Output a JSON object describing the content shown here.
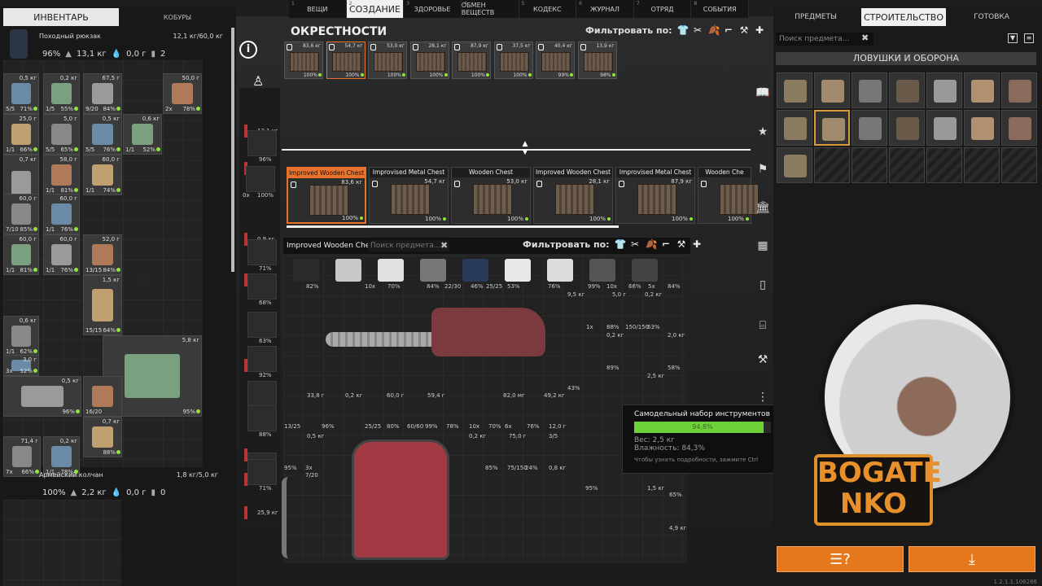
{
  "top_tabs": [
    {
      "n": "1",
      "label": "ВЕЩИ"
    },
    {
      "n": "2",
      "label": "СОЗДАНИЕ",
      "active": true
    },
    {
      "n": "3",
      "label": "ЗДОРОВЬЕ"
    },
    {
      "n": "4",
      "label": "ОБМЕН ВЕЩЕСТВ"
    },
    {
      "n": "5",
      "label": "КОДЕКС"
    },
    {
      "n": "6",
      "label": "ЖУРНАЛ"
    },
    {
      "n": "7",
      "label": "ОТРЯД"
    },
    {
      "n": "8",
      "label": "СОБЫТИЯ"
    }
  ],
  "inventory": {
    "tab_label": "ИНВЕНТАРЬ",
    "holsters_label": "КОБУРЫ",
    "backpack": {
      "name": "Походный рюкзак",
      "weight": "12,1 кг/60,0 кг",
      "condition": "96%",
      "weight2": "13,1 кг",
      "zero": "0,0 г",
      "count": "2"
    },
    "quiver": {
      "name": "Армейский колчан",
      "weight": "1,8 кг/5,0 кг",
      "condition": "100%",
      "weight2": "2,2 кг",
      "zero": "0,0 г",
      "count": "0"
    },
    "cells": [
      {
        "tr": "0,5 кг",
        "bl": "5/5",
        "br": "71%"
      },
      {
        "tr": "0,2 кг",
        "bl": "1/5",
        "br": "55%"
      },
      {
        "tr": "67,5 г",
        "bl": "9/20",
        "br": "84%"
      },
      {
        "tr": "50,0 г",
        "bl": "2x",
        "br": "78%"
      },
      {
        "tr": "25,0 г",
        "bl": "1/1",
        "br": "66%"
      },
      {
        "tr": "5,0 г",
        "bl": "5/5",
        "br": "65%"
      },
      {
        "tr": "0,5 кг",
        "bl": "5/5",
        "br": "76%"
      },
      {
        "tr": "0,6 кг",
        "bl": "1/1",
        "br": "52%"
      },
      {
        "tr": "0,7 кг",
        "bl": "1/1",
        "br": "81%"
      },
      {
        "tr": "58,0 г",
        "bl": "1/1",
        "br": "81%"
      },
      {
        "tr": "60,0 г",
        "bl": "1/1",
        "br": "74%"
      },
      {
        "tr": "60,0 г",
        "bl": "7/10",
        "br": "85%"
      },
      {
        "tr": "60,0 г",
        "bl": "1/1",
        "br": "76%"
      },
      {
        "tr": "60,0 г",
        "bl": "1/1",
        "br": "81%"
      },
      {
        "tr": "60,0 г",
        "bl": "1/1",
        "br": "76%"
      },
      {
        "tr": "52,0 г",
        "bl": "13/15",
        "br": "84%"
      },
      {
        "tr": "1,5 кг",
        "bl": "15/15",
        "br": "64%"
      },
      {
        "tr": "0,6 кг",
        "bl": "1/1",
        "br": "62%"
      },
      {
        "tr": "3,0 г",
        "bl": "3x",
        "br": "52%"
      },
      {
        "tr": "5,8 кг",
        "bl": "",
        "br": "95%"
      },
      {
        "tr": "0,5 кг",
        "bl": "",
        "br": "96%"
      },
      {
        "tr": "",
        "bl": "16/20",
        "br": ""
      },
      {
        "tr": "0,7 кг",
        "bl": "",
        "br": "88%"
      },
      {
        "tr": "71,4 г",
        "bl": "7x",
        "br": "66%"
      },
      {
        "tr": "0,2 кг",
        "bl": "1/1",
        "br": "78%"
      },
      {
        "tr": "0,6 кг",
        "bl": "3/4",
        "br": "55%"
      },
      {
        "tr": "16,0 г",
        "bl": "8x",
        "br": "21%"
      },
      {
        "tr": "20,0 г",
        "bl": "10x",
        "br": "1,0 кг"
      }
    ],
    "extra_labels": [
      "75,0 мг",
      "0,7 кг",
      "5/5",
      "95,0 мг",
      "89%",
      "0,8 кг",
      "0x"
    ]
  },
  "body": {
    "weights": [
      "13,1 кг",
      "2,2 кг",
      "0,9 кг",
      "1,5 кг",
      "0,8 кг",
      "0,5 кг",
      "1,0 кг",
      "25,9 кг"
    ],
    "percents": [
      "96%",
      "100%",
      "71%",
      "68%",
      "63%",
      "92%",
      "93%",
      "88%",
      "63%",
      "71%"
    ],
    "ratio": "0x"
  },
  "vicinity": {
    "title": "ОКРЕСТНОСТИ",
    "filter_label": "Фильтровать по:",
    "crates": [
      {
        "w": "83,6 кг",
        "p": "100%"
      },
      {
        "w": "54,7 кг",
        "p": "100%"
      },
      {
        "w": "53,0 кг",
        "p": "100%"
      },
      {
        "w": "28,1 кг",
        "p": "100%"
      },
      {
        "w": "87,9 кг",
        "p": "100%"
      },
      {
        "w": "37,5 кг",
        "p": "100%"
      },
      {
        "w": "40,4 кг",
        "p": "99%"
      },
      {
        "w": "13,9 кг",
        "p": "98%"
      }
    ],
    "big_crates": [
      {
        "name": "Improved Wooden Chest",
        "w": "83,6 кг",
        "p": "100%",
        "sel": true
      },
      {
        "name": "Improvised Metal Chest",
        "w": "54,7 кг",
        "p": "100%"
      },
      {
        "name": "Wooden Chest",
        "w": "53,0 кг",
        "p": "100%"
      },
      {
        "name": "Improved Wooden Chest",
        "w": "28,1 кг",
        "p": "100%"
      },
      {
        "name": "Improvised Metal Chest",
        "w": "87,9 кг",
        "p": "100%"
      },
      {
        "name": "Wooden Che",
        "w": "",
        "p": "100%"
      }
    ]
  },
  "container": {
    "title": "Improved Wooden Chest",
    "search_placeholder": "Поиск предмета...",
    "filter_label": "Фильтровать по:",
    "labels_row1": [
      {
        "t": "82%"
      },
      {
        "t": "10x"
      },
      {
        "t": "70%"
      },
      {
        "t": "84%"
      },
      {
        "t": "22/30"
      },
      {
        "t": "46%"
      },
      {
        "t": "25/25"
      },
      {
        "t": "53%"
      },
      {
        "t": "76%"
      },
      {
        "t": "99%"
      },
      {
        "t": "10x"
      },
      {
        "t": "66%"
      },
      {
        "t": "5x"
      },
      {
        "t": "84%"
      }
    ],
    "misc": [
      "9,5 кг",
      "5,0 г",
      "0,2 кг",
      "1x",
      "88%",
      "150/150",
      "63%",
      "0,2 кг",
      "2,0 кг",
      "89%",
      "58%",
      "2,5 кг",
      "43%",
      "33,8 г",
      "0,2 кг",
      "60,0 г",
      "59,4 г",
      "82,0 мг",
      "49,2 кг",
      "13/25",
      "96%",
      "25/25",
      "80%",
      "60/60",
      "99%",
      "78%",
      "10x",
      "70%",
      "6x",
      "76%",
      "12,0 г",
      "0,5 кг",
      "0,2 кг",
      "75,0 г",
      "3/5",
      "95%",
      "3x",
      "85%",
      "75/150",
      "24%",
      "0,8 кг",
      "7/20",
      "95%",
      "1,5 кг",
      "65%",
      "4,9 кг"
    ]
  },
  "tooltip": {
    "title": "Самодельный набор инструментов",
    "condition_value": 0.948,
    "condition_text": "94,8%",
    "weight": "Вес: 2,5 кг",
    "humidity": "Влажность: 84,3%",
    "hint": "Чтобы узнать подробности, зажмите Ctrl"
  },
  "right_panel": {
    "tabs": [
      "ПРЕДМЕТЫ",
      "СТРОИТЕЛЬСТВО",
      "ГОТОВКА"
    ],
    "active_tab": 1,
    "search_placeholder": "Поиск предмета...",
    "category": "ЛОВУШКИ И ОБОРОНА",
    "version": "1.2.1.1.106286"
  },
  "logo": {
    "line1": "BOGATE",
    "line2": "NKO"
  },
  "colors": {
    "accent": "#e8722c",
    "ok": "#8ee63a",
    "orange_button": "#e5781c"
  }
}
